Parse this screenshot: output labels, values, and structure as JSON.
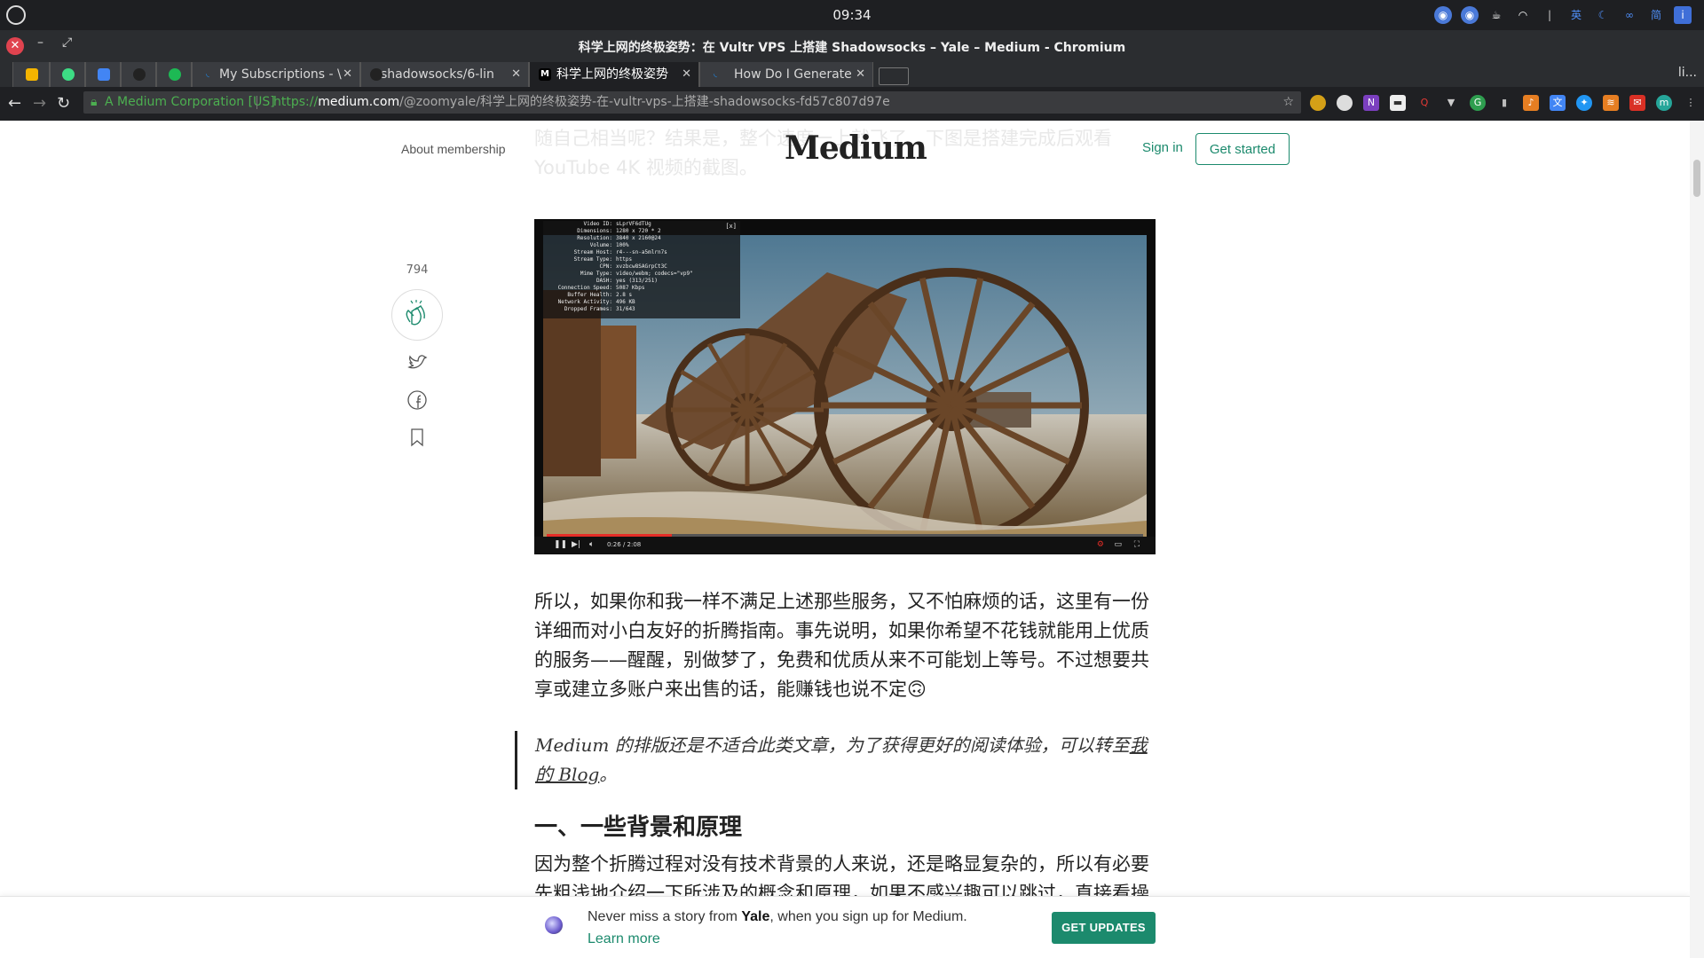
{
  "system": {
    "clock": "09:34"
  },
  "window": {
    "title": "科学上网的终极姿势：在 Vultr VPS 上搭建 Shadowsocks – Yale – Medium - Chromium"
  },
  "tabs": [
    {
      "label": "",
      "icon": "drive-icon",
      "color": "#f4b400"
    },
    {
      "label": "",
      "icon": "rss-icon",
      "color": "#3ddc84"
    },
    {
      "label": "",
      "icon": "translate-icon",
      "color": "#4285f4"
    },
    {
      "label": "",
      "icon": "github-icon",
      "color": "#333333"
    },
    {
      "label": "",
      "icon": "spotify-icon",
      "color": "#1db954"
    },
    {
      "label": "My Subscriptions - \\",
      "icon": "d-icon",
      "color": "#1e88e5"
    },
    {
      "label": "shadowsocks/6-lin",
      "icon": "github-icon",
      "color": "#333333"
    },
    {
      "label": "科学上网的终极姿势",
      "icon": "medium-icon",
      "color": "#000000"
    },
    {
      "label": "How Do I Generate",
      "icon": "d-icon",
      "color": "#1e88e5"
    }
  ],
  "tab_overflow": "li...",
  "omnibox": {
    "org": "A Medium Corporation [US]",
    "scheme": "https://",
    "host": "medium.com",
    "path": "/@zoomyale/科学上网的终极姿势-在-vultr-vps-上搭建-shadowsocks-fd57c807d97e"
  },
  "header": {
    "membership": "About membership",
    "logo": "Medium",
    "signin": "Sign in",
    "get_started": "Get started"
  },
  "faded_text": "随自己相当呢？结果是，整个速度一上就飞了…下图是搭建完成后观看 YouTube 4K 视频的截图。",
  "rail": {
    "clap_count": "794"
  },
  "video": {
    "stats": [
      {
        "k": "Video ID:",
        "v": "sLprVF6dTUg"
      },
      {
        "k": "Dimensions:",
        "v": "1280 x 720 * 2"
      },
      {
        "k": "Resolution:",
        "v": "3840 x 2160@24"
      },
      {
        "k": "Volume:",
        "v": "100%"
      },
      {
        "k": "Stream Host:",
        "v": "r4---sn-a5mlrn7s"
      },
      {
        "k": "Stream Type:",
        "v": "https"
      },
      {
        "k": "CPN:",
        "v": "xvzbcw8SAGrpCt3C"
      },
      {
        "k": "Mime Type:",
        "v": "video/webm; codecs=\"vp9\""
      },
      {
        "k": "DASH:",
        "v": "yes (313/251)"
      },
      {
        "k": "Connection Speed:",
        "v": "5087 Kbps"
      },
      {
        "k": "Buffer Health:",
        "v": "2.8 s"
      },
      {
        "k": "Network Activity:",
        "v": "496 KB"
      },
      {
        "k": "Dropped Frames:",
        "v": "31/643"
      }
    ],
    "time": "0:26 / 2:08",
    "progress": 0.21
  },
  "article": {
    "para1": "所以，如果你和我一样不满足上述那些服务，又不怕麻烦的话，这里有一份详细而对小白友好的折腾指南。事先说明，如果你希望不花钱就能用上优质的服务——醒醒，别做梦了，免费和优质从来不可能划上等号。不过想要共享或建立多账户来出售的话，能赚钱也说不定🙃",
    "quote_text": "Medium 的排版还是不适合此类文章，为了获得更好的阅读体验，可以转至",
    "quote_link": "我的 Blog",
    "quote_end": "。",
    "heading": "一、一些背景和原理",
    "para2": "因为整个折腾过程对没有技术背景的人来说，还是略显复杂的，所以有必要先粗浅地介绍一下所涉及的概念和原理，如果不感兴趣可以跳过，直接看操"
  },
  "banner": {
    "pre": "Never miss a story from ",
    "author": "Yale",
    "post": ", when you sign up for Medium. ",
    "learn": "Learn more",
    "cta": "GET UPDATES"
  },
  "colors": {
    "accent": "#1c8a6d",
    "chrome_dark": "#1f2023"
  }
}
